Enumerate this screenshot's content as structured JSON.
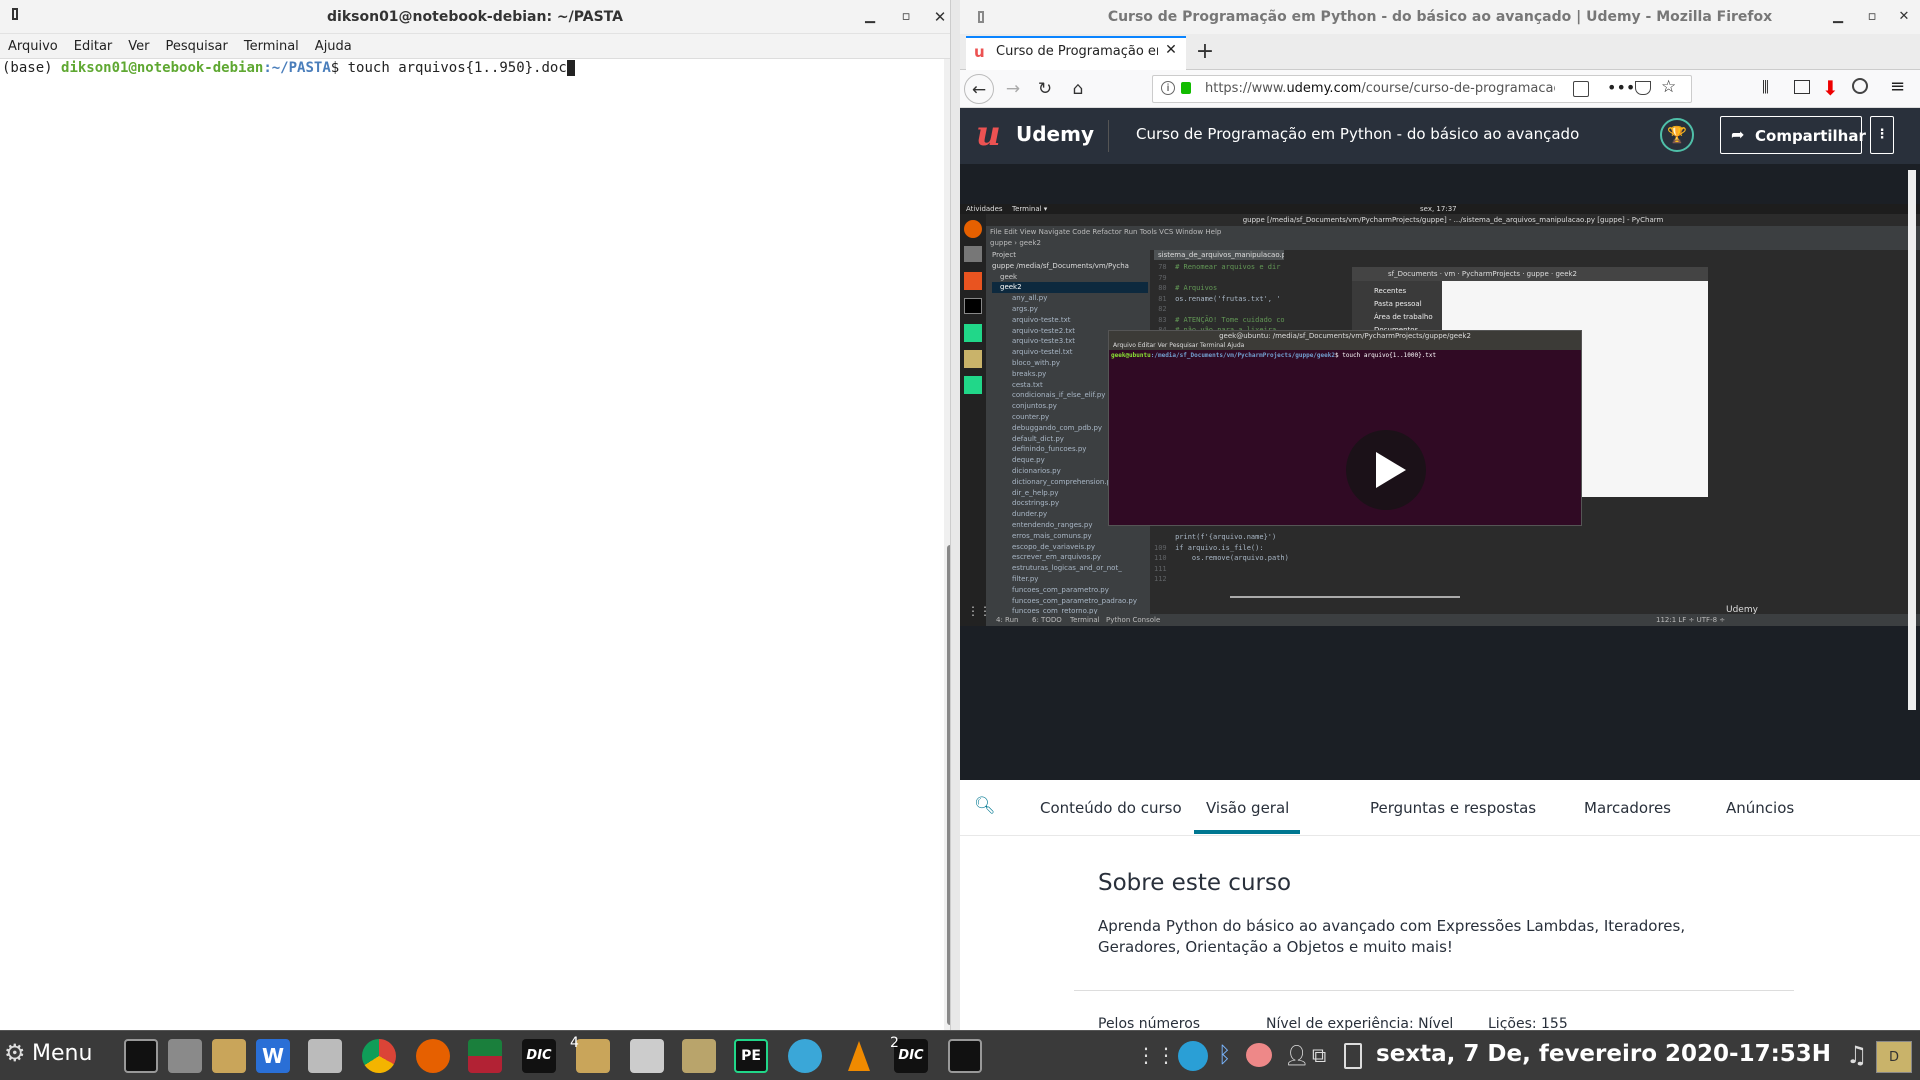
{
  "terminal": {
    "title": "dikson01@notebook-debian: ~/PASTA",
    "menu": [
      "Arquivo",
      "Editar",
      "Ver",
      "Pesquisar",
      "Terminal",
      "Ajuda"
    ],
    "prompt_env": "(base)",
    "prompt_user": "dikson01@notebook-debian",
    "prompt_path": ":~/PASTA",
    "prompt_sign": "$",
    "command": "touch arquivos{1..950}.doc"
  },
  "firefox": {
    "title": "Curso de Programação em Python - do básico ao avançado | Udemy - Mozilla Firefox",
    "tab_label": "Curso de Programação em",
    "url_prefix": "https://www.",
    "url_domain": "udemy.com",
    "url_path": "/course/curso-de-programacao"
  },
  "udemy": {
    "logo": "Udemy",
    "course_title": "Curso de Programação em Python - do básico ao avançado",
    "share_label": "Compartilhar",
    "tabs": [
      "Conteúdo do curso",
      "Visão geral",
      "Perguntas e respostas",
      "Marcadores",
      "Anúncios"
    ],
    "active_tab": "Visão geral",
    "section_title": "Sobre este curso",
    "description": "Aprenda Python do básico ao avançado com Expressões Lambdas, Iteradores, Geradores, Orientação a Objetos e muito mais!",
    "stats": [
      "Pelos números",
      "Nível de experiência: Nível",
      "Lições: 155"
    ]
  },
  "video": {
    "desktop_bar_left": "Atividades",
    "desktop_bar_app": "Terminal ▾",
    "desktop_bar_clock": "sex, 17:37",
    "pycharm_title": "guppe [/media/sf_Documents/vm/PycharmProjects/guppe] - .../sistema_de_arquivos_manipulacao.py [guppe] - PyCharm",
    "pycharm_menu": [
      "File",
      "Edit",
      "View",
      "Navigate",
      "Code",
      "Refactor",
      "Run",
      "Tools",
      "VCS",
      "Window",
      "Help"
    ],
    "breadcrumb": [
      "guppe",
      "geek2"
    ],
    "project_label": "Project",
    "editor_tab": "sistema_de_arquivos_manipulacao.py",
    "tree_root": "guppe  /media/sf_Documents/vm/Pycha",
    "tree_folders": [
      "geek",
      "geek2"
    ],
    "files": [
      "any_all.py",
      "args.py",
      "arquivo-teste.txt",
      "arquivo-teste2.txt",
      "arquivo-teste3.txt",
      "arquivo-testel.txt",
      "bloco_with.py",
      "breaks.py",
      "cesta.txt",
      "condicionais_if_else_elif.py",
      "conjuntos.py",
      "counter.py",
      "debuggando_com_pdb.py",
      "default_dict.py",
      "definindo_funcoes.py",
      "deque.py",
      "dicionarios.py",
      "dictionary_comprehension.py",
      "dir_e_help.py",
      "docstrings.py",
      "dunder.py",
      "entendendo_ranges.py",
      "erros_mais_comuns.py",
      "escopo_de_variaveis.py",
      "escrever_em_arquivos.py",
      "estruturas_logicas_and_or_not_",
      "filter.py",
      "funcoes_com_parametro.py",
      "funcoes_com_parametro_padrao.py",
      "funcoes_com_retorno.py",
      "generators.py",
      "kwargs.py",
      "lambdas.py",
      "leitura_de_arquivos.py",
      "len-abs-sum-round.py",
      "list_comprehension_p1.py",
      "list_comprehension_p2.py",
      "listas.py"
    ],
    "code_top": [
      {
        "n": "78",
        "t": "# Renomear arquivos e dir"
      },
      {
        "n": "79",
        "t": ""
      },
      {
        "n": "80",
        "t": "# Arquivos"
      },
      {
        "n": "81",
        "t": "os.rename('frutas.txt', '"
      },
      {
        "n": "82",
        "t": ""
      },
      {
        "n": "83",
        "t": "# ATENÇÃO! Tome cuidado co"
      },
      {
        "n": "84",
        "t": "# não vão para a lixeira."
      }
    ],
    "code_bottom": [
      {
        "n": "",
        "t": "print(f'{arquivo.name}')"
      },
      {
        "n": "109",
        "t": "if arquivo.is_file():"
      },
      {
        "n": "110",
        "t": "    os.remove(arquivo.path)"
      },
      {
        "n": "111",
        "t": ""
      },
      {
        "n": "112",
        "t": ""
      }
    ],
    "filedialog_path": [
      "sf_Documents",
      "vm",
      "PycharmProjects",
      "guppe",
      "geek2"
    ],
    "filedialog_places": [
      "Recentes",
      "Pasta pessoal",
      "Área de trabalho",
      "Documentos"
    ],
    "inner_term_title": "geek@ubuntu: /media/sf_Documents/vm/PycharmProjects/guppe/geek2",
    "inner_term_menu": [
      "Arquivo",
      "Editar",
      "Ver",
      "Pesquisar",
      "Terminal",
      "Ajuda"
    ],
    "inner_prompt": "geek@ubuntu",
    "inner_path": ":/media/sf_Documents/vm/PycharmProjects/guppe/geek2",
    "inner_cmd": "$ touch arquivo{1..1000}.txt",
    "status_tabs": [
      "4: Run",
      "6: TODO",
      "Terminal",
      "Python Console"
    ],
    "status_right": "112:1  LF ÷  UTF-8 ÷",
    "watermark": "Udemy"
  },
  "taskbar": {
    "menu_label": "Menu",
    "badge_a": "4",
    "badge_b": "2",
    "dic_label": "DIC",
    "pe_label": "PE",
    "clock": "sexta, 7 De, fevereiro 2020-17:53H",
    "tray_box": "D"
  }
}
